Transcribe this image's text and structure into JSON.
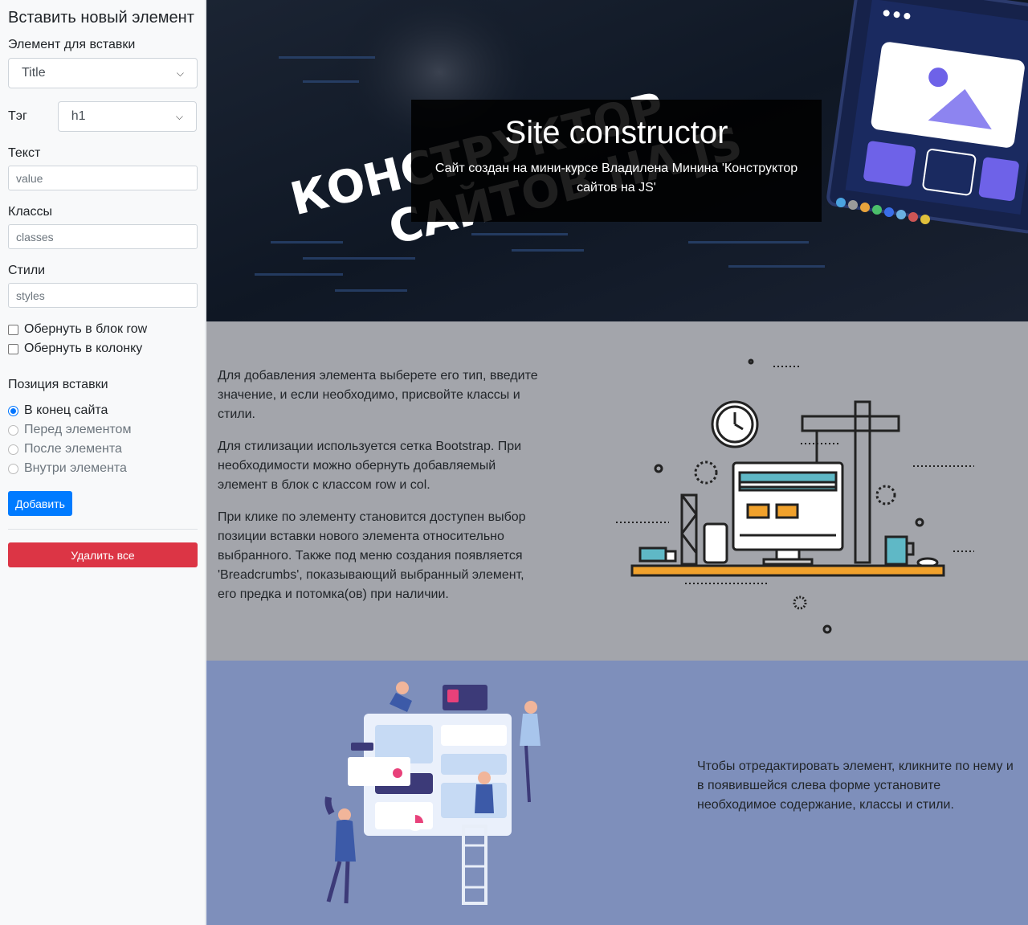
{
  "sidebar": {
    "title": "Вставить новый элемент",
    "element_label": "Элемент для вставки",
    "element_value": "Title",
    "tag_label": "Тэг",
    "tag_value": "h1",
    "text_label": "Текст",
    "text_placeholder": "value",
    "classes_label": "Классы",
    "classes_placeholder": "classes",
    "styles_label": "Стили",
    "styles_placeholder": "styles",
    "wrap_row": "Обернуть в блок row",
    "wrap_col": "Обернуть в колонку",
    "position_label": "Позиция вставки",
    "positions": [
      "В конец сайта",
      "Перед элементом",
      "После элемента",
      "Внутри элемента"
    ],
    "add_button": "Добавить",
    "delete_all_button": "Удалить все"
  },
  "hero": {
    "title": "Site constructor",
    "subtitle": "Сайт создан на мини-курсе Владилена Минина 'Конструктор сайтов на JS'",
    "bg_text_line1": "КОНСТРУКТОР",
    "bg_text_line2": "САЙТОВ НА JS"
  },
  "section2": {
    "paragraphs": [
      "Для добавления элемента выберете его тип, введите значение, и если необходимо, присвойте классы и стили.",
      "Для стилизации используется сетка Bootstrap. При необходимости можно обернуть добавляемый элемент в блок с классом row и col.",
      "При клике по элементу становится доступен выбор позиции вставки нового элемента относительно выбранного. Также под меню создания появляется 'Breadcrumbs', показывающий выбранный элемент, его предка и потомка(ов) при наличии."
    ]
  },
  "section3": {
    "text": "Чтобы отредактировать элемент, кликните по нему и в появившейся слева форме установите необходимое содержание, классы и стили."
  },
  "colors": {
    "primary": "#007bff",
    "danger": "#dc3545",
    "section2_bg": "#a3a5ab",
    "section3_bg": "#7e8fbb"
  },
  "icons": [
    "chevron-down-icon",
    "checkbox-icon",
    "radio-icon"
  ]
}
